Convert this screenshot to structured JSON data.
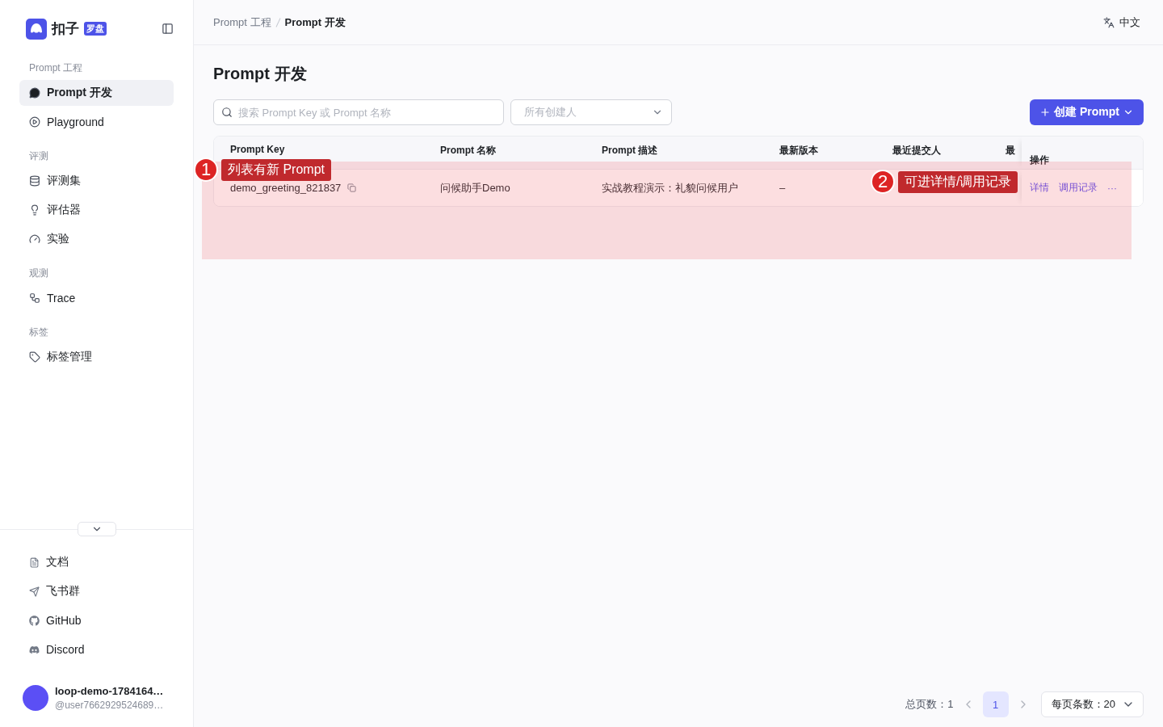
{
  "logo": {
    "name": "扣子",
    "badge": "罗盘"
  },
  "sidebar": {
    "groups": [
      {
        "title": "Prompt 工程",
        "items": [
          {
            "label": "Prompt 开发",
            "selected": true
          },
          {
            "label": "Playground",
            "selected": false
          }
        ]
      },
      {
        "title": "评测",
        "items": [
          {
            "label": "评测集",
            "selected": false
          },
          {
            "label": "评估器",
            "selected": false
          },
          {
            "label": "实验",
            "selected": false
          }
        ]
      },
      {
        "title": "观测",
        "items": [
          {
            "label": "Trace",
            "selected": false
          }
        ]
      },
      {
        "title": "标签",
        "items": [
          {
            "label": "标签管理",
            "selected": false
          }
        ]
      }
    ],
    "footer_items": [
      "文档",
      "飞书群",
      "GitHub",
      "Discord"
    ],
    "user": {
      "name": "loop-demo-1784164…",
      "handle": "@user7662929524689…"
    }
  },
  "breadcrumb": [
    "Prompt 工程",
    "Prompt 开发"
  ],
  "language": "中文",
  "page_title": "Prompt 开发",
  "search": {
    "placeholder": "搜索 Prompt Key 或 Prompt 名称"
  },
  "creator_filter": {
    "placeholder": "所有创建人"
  },
  "create_button": "创建 Prompt",
  "table": {
    "columns": [
      "Prompt Key",
      "Prompt 名称",
      "Prompt 描述",
      "最新版本",
      "最近提交人",
      "最"
    ],
    "action_column": "操作",
    "rows": [
      {
        "key": "demo_greeting_821837",
        "name": "问候助手Demo",
        "description": "实战教程演示：礼貌问候用户",
        "version": "–",
        "actions": [
          "详情",
          "调用记录",
          "···"
        ]
      }
    ]
  },
  "pagination": {
    "total": "总页数：1",
    "pages": [
      {
        "label": "1",
        "selected": true
      }
    ],
    "page_size": "每页条数：20"
  },
  "annotations": [
    {
      "number": "1",
      "text": "列表有新 Prompt"
    },
    {
      "number": "2",
      "text": "可进详情/调用记录"
    }
  ]
}
